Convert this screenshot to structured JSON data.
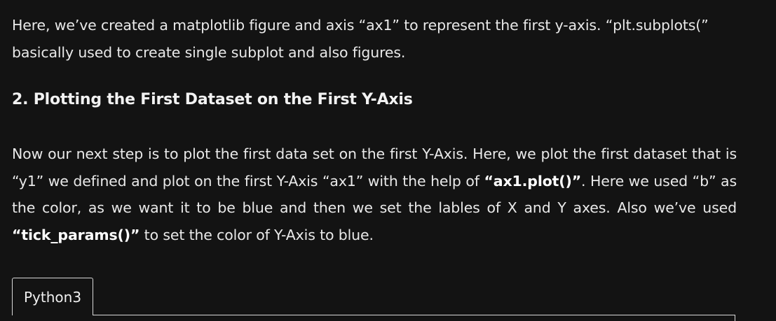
{
  "article": {
    "intro": "Here, we’ve created a matplotlib figure and axis “ax1” to represent the first y-axis. “plt.subplots(” basically used to create single subplot and also figures.",
    "heading": "2. Plotting the First Dataset on the First Y-Axis",
    "body": {
      "part1": "Now our next step is to plot the first data set on the first Y-Axis. Here, we plot the first dataset that is “y1” we defined and plot on the first Y-Axis “ax1” with the help of ",
      "bold1": "“ax1.plot()”",
      "part2": ". Here we used “b” as the color, as we want it to be blue and then we set the lables of X and Y axes. Also we’ve used ",
      "bold2": "“tick_params()”",
      "part3": " to set the color of Y-Axis to blue."
    }
  },
  "code_block": {
    "tab_label": "Python3"
  }
}
